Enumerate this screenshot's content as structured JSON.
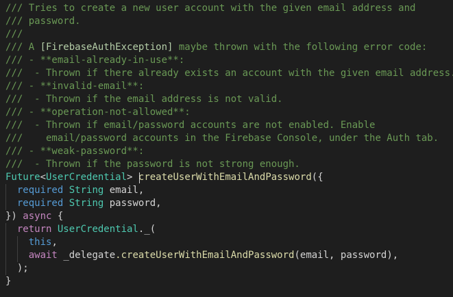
{
  "doc_comments": [
    "/// Tries to create a new user account with the given email address and",
    "/// password.",
    "///",
    "/// A ",
    "/// - **email-already-in-use**:",
    "///  - Thrown if there already exists an account with the given email address.",
    "/// - **invalid-email**:",
    "///  - Thrown if the email address is not valid.",
    "/// - **operation-not-allowed**:",
    "///  - Thrown if email/password accounts are not enabled. Enable",
    "///    email/password accounts in the Firebase Console, under the Auth tab.",
    "/// - **weak-password**:",
    "///  - Thrown if the password is not strong enough."
  ],
  "ref_line": {
    "prefix": "/// A ",
    "ref": "[FirebaseAuthException]",
    "suffix": " maybe thrown with the following error code:"
  },
  "signature": {
    "return_type_outer": "Future",
    "lt": "<",
    "return_type_inner": "UserCredential",
    "gt": "> ",
    "method_name": "createUserWithEmailAndPassword",
    "open": "({"
  },
  "params": [
    {
      "keyword": "required",
      "type": "String",
      "name": "email,"
    },
    {
      "keyword": "required",
      "type": "String",
      "name": "password,"
    }
  ],
  "close_params": "}) ",
  "async_kw": "async",
  "open_brace": " {",
  "return_kw": "return",
  "return_type": "UserCredential",
  "return_ctor": "._(",
  "this_kw": "this",
  "comma": ",",
  "await_kw": "await",
  "delegate": "_delegate",
  "delegate_call": ".createUserWithEmailAndPassword",
  "delegate_args": "(email, password),",
  "close_call": ");",
  "close_body": "}"
}
